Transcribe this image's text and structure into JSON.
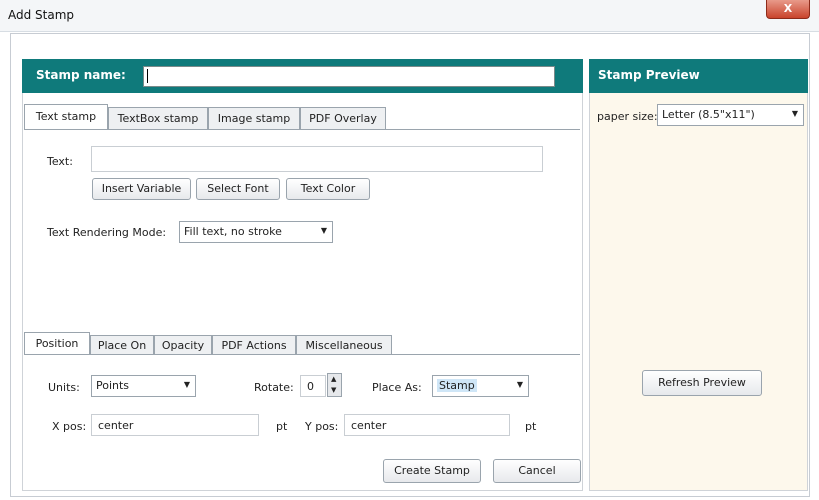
{
  "window": {
    "title": "Add Stamp",
    "close_label": "X"
  },
  "stamp_name": {
    "label": "Stamp name:",
    "value": ""
  },
  "tabs": [
    "Text stamp",
    "TextBox stamp",
    "Image stamp",
    "PDF Overlay"
  ],
  "text_stamp": {
    "text_label": "Text:",
    "text_value": "",
    "insert_variable": "Insert Variable",
    "select_font": "Select Font",
    "text_color": "Text Color",
    "rendering_mode_label": "Text Rendering Mode:",
    "rendering_mode_value": "Fill text, no stroke"
  },
  "bottom_tabs": [
    "Position",
    "Place On",
    "Opacity",
    "PDF Actions",
    "Miscellaneous"
  ],
  "position": {
    "units_label": "Units:",
    "units_value": "Points",
    "rotate_label": "Rotate:",
    "rotate_value": "0",
    "place_as_label": "Place As:",
    "place_as_value": "Stamp",
    "xpos_label": "X pos:",
    "xpos_value": "center",
    "xpos_unit": "pt",
    "ypos_label": "Y pos:",
    "ypos_value": "center",
    "ypos_unit": "pt"
  },
  "actions": {
    "create": "Create Stamp",
    "cancel": "Cancel"
  },
  "preview": {
    "title": "Stamp Preview",
    "paper_size_label": "paper size:",
    "paper_size_value": "Letter (8.5\"x11\")",
    "refresh": "Refresh Preview"
  },
  "colors": {
    "accent": "#0f7a7b",
    "preview_bg": "#fdf8ec"
  }
}
